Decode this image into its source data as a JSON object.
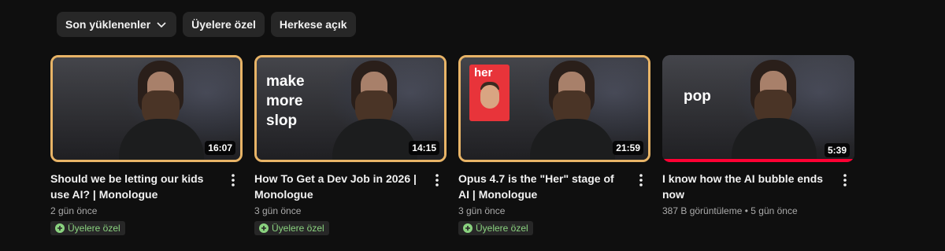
{
  "filters": {
    "sort_label": "Son yüklenenler",
    "members_label": "Üyelere özel",
    "public_label": "Herkese açık"
  },
  "videos": [
    {
      "title": "Should we be letting our kids use AI? | Monologue",
      "duration": "16:07",
      "meta": "2 gün önce",
      "badge": "Üyelere özel",
      "overlay": ""
    },
    {
      "title": "How To Get a Dev Job in 2026 | Monologue",
      "duration": "14:15",
      "meta": "3 gün önce",
      "badge": "Üyelere özel",
      "overlay": "make\nmore\nslop"
    },
    {
      "title": "Opus 4.7 is the \"Her\" stage of AI | Monologue",
      "duration": "21:59",
      "meta": "3 gün önce",
      "badge": "Üyelere özel",
      "poster_text": "her"
    },
    {
      "title": "I know how the AI bubble ends now",
      "duration": "5:39",
      "meta": "387 B görüntüleme • 5 gün önce",
      "overlay": "pop"
    }
  ],
  "colors": {
    "members_border": "#e8b467",
    "badge_text": "#8ad27f",
    "progress": "#ff0033"
  },
  "icons": {
    "chevron": "chevron-down-icon",
    "more": "more-vert-icon",
    "members": "plus-circle-icon"
  }
}
